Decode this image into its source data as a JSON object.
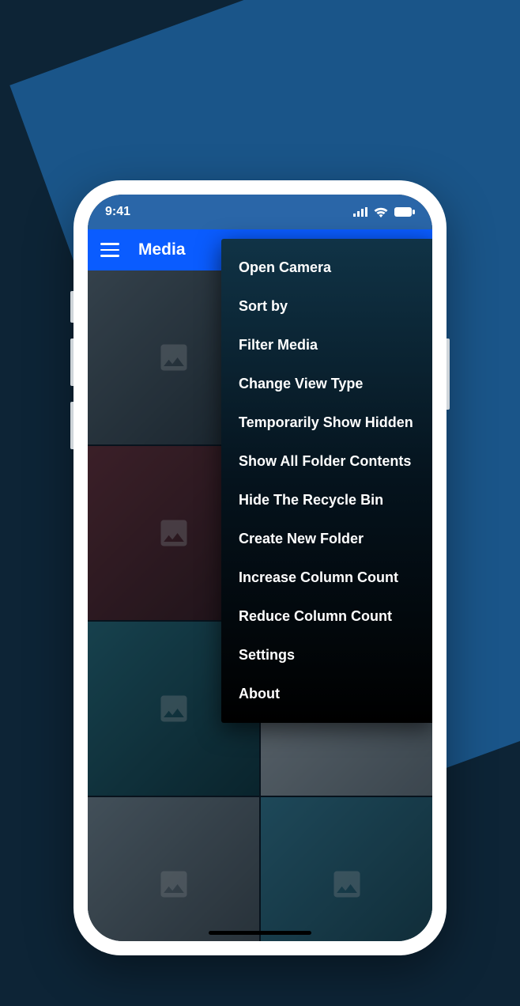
{
  "status": {
    "time": "9:41"
  },
  "appbar": {
    "title": "Media"
  },
  "menu": {
    "items": [
      {
        "label": "Open Camera"
      },
      {
        "label": "Sort by"
      },
      {
        "label": "Filter Media"
      },
      {
        "label": "Change View Type"
      },
      {
        "label": "Temporarily Show Hidden"
      },
      {
        "label": "Show All Folder Contents"
      },
      {
        "label": "Hide The Recycle Bin"
      },
      {
        "label": "Create New Folder"
      },
      {
        "label": "Increase Column Count"
      },
      {
        "label": "Reduce Column Count"
      },
      {
        "label": "Settings"
      },
      {
        "label": "About"
      }
    ]
  }
}
